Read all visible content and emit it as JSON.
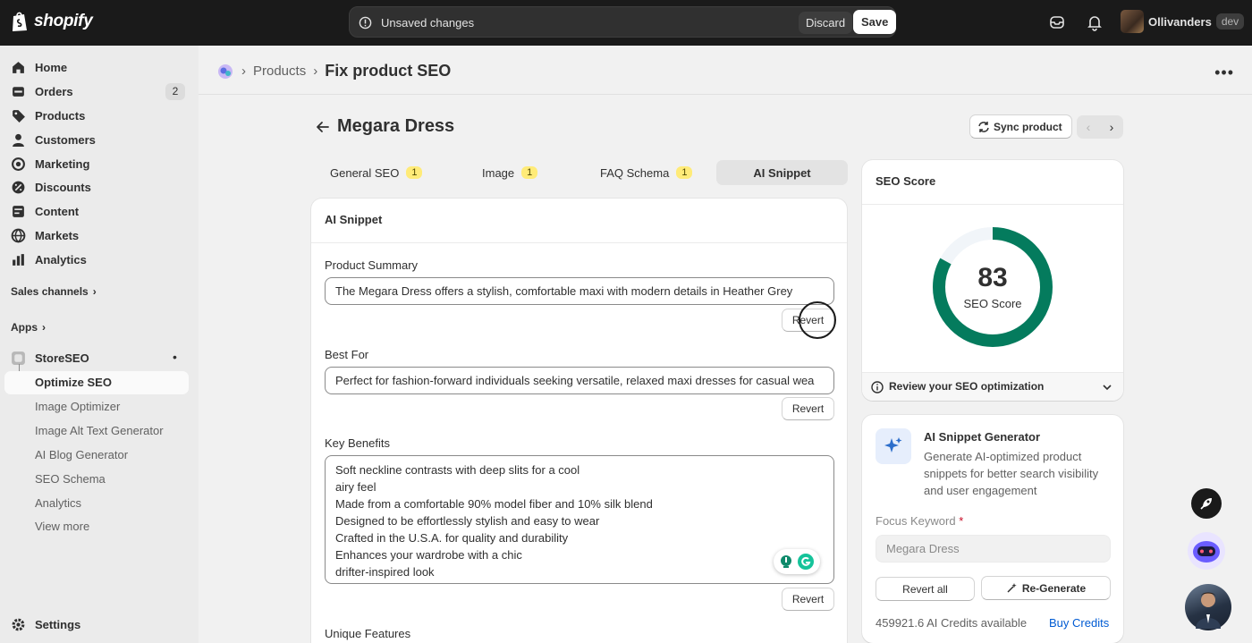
{
  "topbar": {
    "logo_text": "shopify",
    "unsaved_message": "Unsaved changes",
    "discard_label": "Discard",
    "save_label": "Save",
    "store_name": "Ollivanders",
    "store_badge": "dev"
  },
  "sidebar": {
    "items": [
      {
        "label": "Home"
      },
      {
        "label": "Orders",
        "count": "2"
      },
      {
        "label": "Products"
      },
      {
        "label": "Customers"
      },
      {
        "label": "Marketing"
      },
      {
        "label": "Discounts"
      },
      {
        "label": "Content"
      },
      {
        "label": "Markets"
      },
      {
        "label": "Analytics"
      }
    ],
    "sales_channels": "Sales channels",
    "apps": "Apps",
    "app_name": "StoreSEO",
    "sub_items": [
      "Optimize SEO",
      "Image Optimizer",
      "Image Alt Text Generator",
      "AI Blog Generator",
      "SEO Schema",
      "Analytics",
      "View more"
    ],
    "settings": "Settings"
  },
  "breadcrumb": {
    "parent": "Products",
    "current": "Fix product SEO"
  },
  "page": {
    "title": "Megara Dress",
    "sync_label": "Sync product"
  },
  "tabs": [
    {
      "label": "General SEO",
      "badge": "1"
    },
    {
      "label": "Image",
      "badge": "1"
    },
    {
      "label": "FAQ Schema",
      "badge": "1"
    },
    {
      "label": "AI Snippet"
    }
  ],
  "snippet_card": {
    "title": "AI Snippet",
    "product_summary_label": "Product Summary",
    "product_summary_value": "The Megara Dress offers a stylish, comfortable maxi with modern details in Heather Grey",
    "best_for_label": "Best For",
    "best_for_value": "Perfect for fashion-forward individuals seeking versatile, relaxed maxi dresses for casual wea",
    "key_benefits_label": "Key Benefits",
    "key_benefits_lines": [
      "Soft neckline contrasts with deep slits for a cool",
      "airy feel",
      "Made from a comfortable 90% model fiber and 10% silk blend",
      "Designed to be effortlessly stylish and easy to wear",
      "Crafted in the U.S.A. for quality and durability",
      "Enhances your wardrobe with a chic",
      "drifter-inspired look"
    ],
    "unique_features_label": "Unique Features",
    "revert_label": "Revert"
  },
  "seo_score": {
    "title": "SEO Score",
    "score": "83",
    "score_value": 83,
    "score_label": "SEO Score",
    "review_label": "Review your SEO optimization",
    "accent_color": "#047b5d"
  },
  "generator": {
    "title": "AI Snippet Generator",
    "description": "Generate AI-optimized product snippets for better search visibility and user engagement",
    "focus_label": "Focus Keyword",
    "focus_required": "*",
    "focus_value": "Megara Dress",
    "revert_all": "Revert all",
    "regenerate": "Re-Generate",
    "credits": "459921.6 AI Credits available",
    "buy_credits": "Buy Credits"
  }
}
